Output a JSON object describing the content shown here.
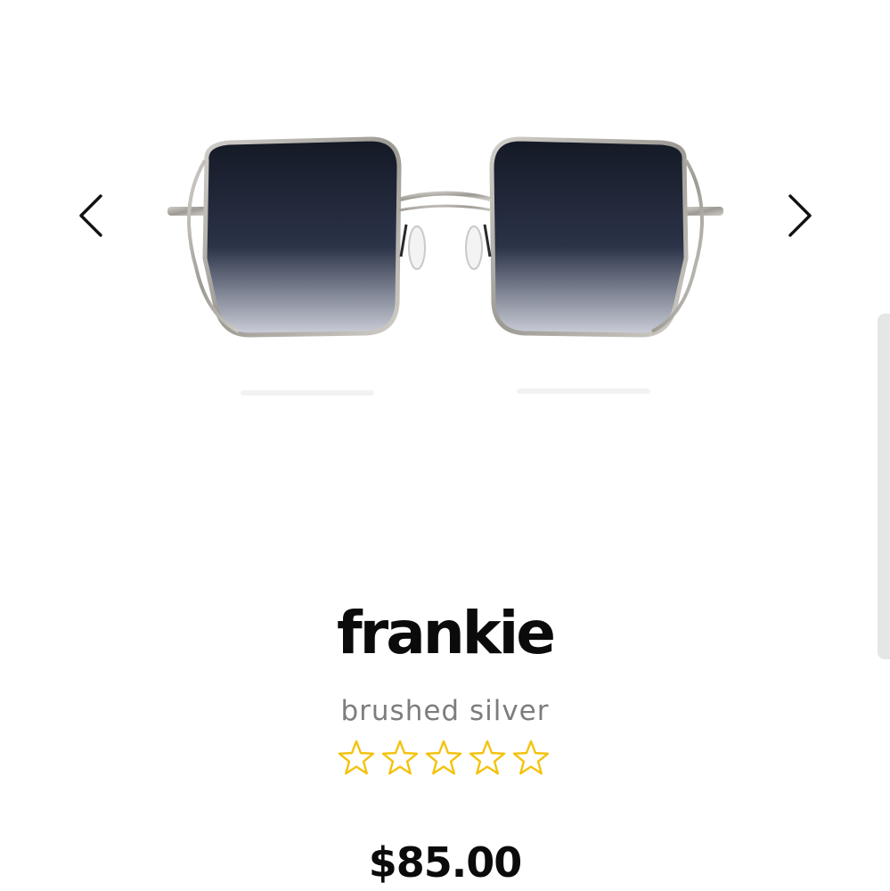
{
  "product": {
    "name": "frankie",
    "color": "brushed silver",
    "price": "$85.00",
    "rating": 0,
    "rating_max": 5,
    "image": "product-photo-sunglasses"
  },
  "carousel": {
    "prev_icon": "chevron-left-icon",
    "next_icon": "chevron-right-icon"
  },
  "colors": {
    "star": "#f4c20d",
    "text_primary": "#0b0b0b",
    "text_secondary": "#7d7d7d",
    "lens": "#1f2433",
    "frame": "#b9b6b0"
  }
}
